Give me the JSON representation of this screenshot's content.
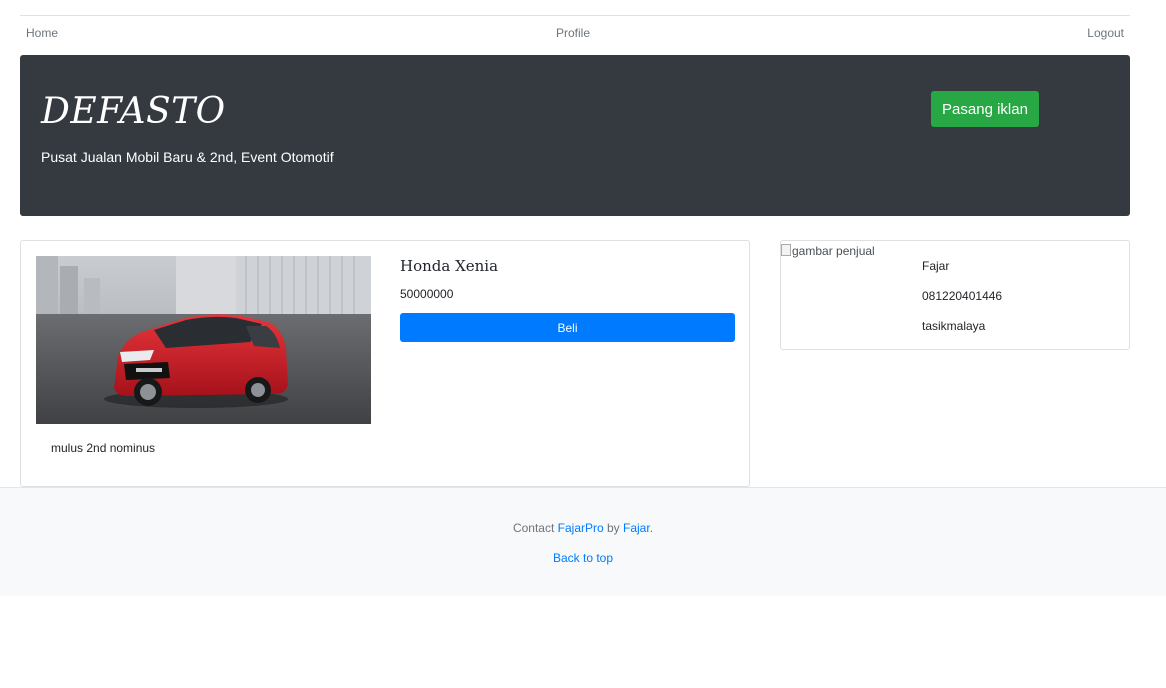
{
  "nav": {
    "home": "Home",
    "profile": "Profile",
    "logout": "Logout"
  },
  "hero": {
    "brand": "DEFASTO",
    "tagline": "Pusat Jualan Mobil Baru & 2nd, Event Otomotif",
    "post_button": "Pasang iklan"
  },
  "listing": {
    "title": "Honda Xenia",
    "price": "50000000",
    "buy_button": "Beli",
    "description": "mulus 2nd nominus",
    "image_alt": "red car photo"
  },
  "seller": {
    "image_alt": "gambar penjual",
    "name": "Fajar",
    "phone": "081220401446",
    "city": "tasikmalaya"
  },
  "footer": {
    "contact_prefix": "Contact ",
    "contact_link": "FajarPro",
    "by_text": " by ",
    "author_link": "Fajar",
    "suffix": ".",
    "back_to_top": "Back to top"
  },
  "colors": {
    "hero_bg": "#343a40",
    "success": "#28a745",
    "primary": "#007bff",
    "car_red": "#d31a23"
  }
}
